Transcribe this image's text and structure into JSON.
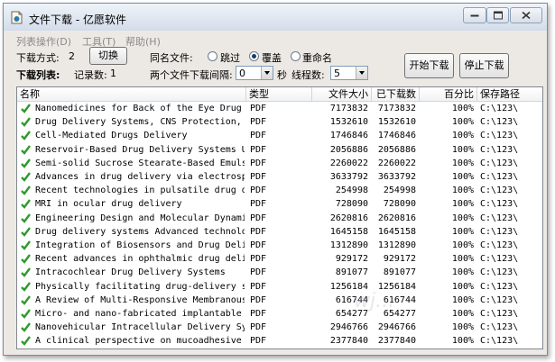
{
  "window": {
    "title": "文件下载 - 亿愿软件"
  },
  "menu": {
    "items": [
      "列表操作(D)",
      "工具(T)",
      "帮助(H)"
    ]
  },
  "controls": {
    "mode_label": "下载方式:",
    "mode_value": "2",
    "switch_button": "切换",
    "same_name_label": "同名文件:",
    "radio_options": [
      {
        "label": "跳过",
        "checked": false
      },
      {
        "label": "覆盖",
        "checked": true
      },
      {
        "label": "重命名",
        "checked": false
      }
    ],
    "list_label": "下载列表:",
    "record_count_label": "记录数:",
    "record_count_value": "1",
    "interval_label": "两个文件下载间隔:",
    "interval_value": "0",
    "interval_unit": "秒",
    "threads_label": "线程数:",
    "threads_value": "5",
    "start_button": "开始下载",
    "stop_button": "停止下载"
  },
  "table": {
    "columns": [
      "名称",
      "类型",
      "文件大小",
      "已下载数",
      "百分比",
      "保存路径"
    ],
    "rows": [
      [
        "Nanomedicines for Back of the Eye Drug D...",
        "PDF",
        "7173832",
        "7173832",
        "100%",
        "C:\\123\\"
      ],
      [
        "Drug Delivery Systems, CNS Protection, a...",
        "PDF",
        "1532610",
        "1532610",
        "100%",
        "C:\\123\\"
      ],
      [
        "Cell-Mediated Drugs Delivery",
        "PDF",
        "1746846",
        "1746846",
        "100%",
        "C:\\123\\"
      ],
      [
        "Reservoir-Based Drug Delivery Systems Ut...",
        "PDF",
        "2056886",
        "2056886",
        "100%",
        "C:\\123\\"
      ],
      [
        "Semi-solid Sucrose Stearate-Based Emulsi...",
        "PDF",
        "2260022",
        "2260022",
        "100%",
        "C:\\123\\"
      ],
      [
        "Advances in drug delivery via electrospu...",
        "PDF",
        "3633792",
        "3633792",
        "100%",
        "C:\\123\\"
      ],
      [
        "Recent technologies in pulsatile drug de...",
        "PDF",
        "254998",
        "254998",
        "100%",
        "C:\\123\\"
      ],
      [
        "MRI in ocular drug delivery",
        "PDF",
        "728090",
        "728090",
        "100%",
        "C:\\123\\"
      ],
      [
        "Engineering Design and Molecular Dynamic...",
        "PDF",
        "2620816",
        "2620816",
        "100%",
        "C:\\123\\"
      ],
      [
        "Drug delivery systems Advanced technolog...",
        "PDF",
        "1645158",
        "1645158",
        "100%",
        "C:\\123\\"
      ],
      [
        "Integration of Biosensors and Drug Deliv...",
        "PDF",
        "1312890",
        "1312890",
        "100%",
        "C:\\123\\"
      ],
      [
        "Recent advances in ophthalmic drug delivery",
        "PDF",
        "929172",
        "929172",
        "100%",
        "C:\\123\\"
      ],
      [
        "Intracochlear Drug Delivery Systems",
        "PDF",
        "891077",
        "891077",
        "100%",
        "C:\\123\\"
      ],
      [
        "Physically facilitating drug-delivery sy...",
        "PDF",
        "1256184",
        "1256184",
        "100%",
        "C:\\123\\"
      ],
      [
        "A Review of Multi-Responsive Membranous ...",
        "PDF",
        "616744",
        "616744",
        "100%",
        "C:\\123\\"
      ],
      [
        "Micro- and nano-fabricated implantable d...",
        "PDF",
        "654277",
        "654277",
        "100%",
        "C:\\123\\"
      ],
      [
        "Nanovehicular Intracellular Delivery Sys...",
        "PDF",
        "2946766",
        "2946766",
        "100%",
        "C:\\123\\"
      ],
      [
        "A clinical perspective on mucoadhesive b...",
        "PDF",
        "2377840",
        "2377840",
        "100%",
        "C:\\123\\"
      ]
    ]
  },
  "watermark": "wj...",
  "colors": {
    "check_green": "#2e9a2e",
    "title_bg": "#dfe7f1"
  }
}
